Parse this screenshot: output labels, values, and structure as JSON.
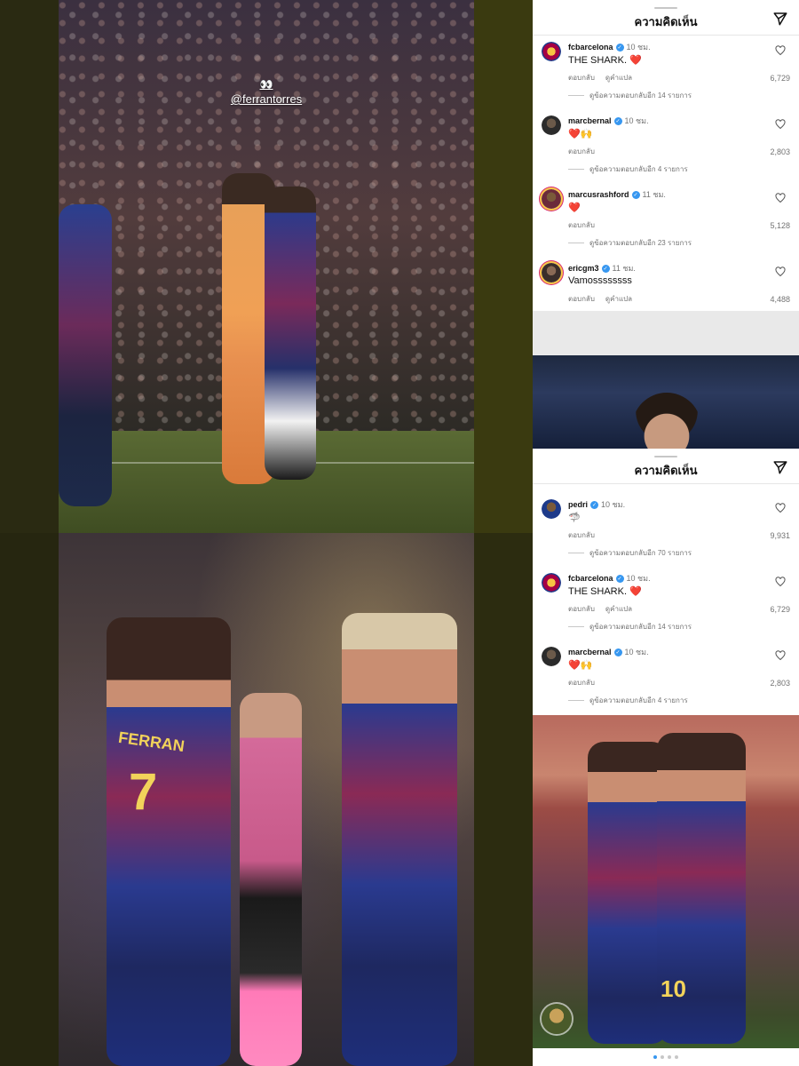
{
  "watermark": {
    "handle": "@ferrantorres",
    "emoji": "👀"
  },
  "photo_bottom": {
    "jersey_name": "FERRAN",
    "jersey_number": "7",
    "right_number": "10"
  },
  "panel1": {
    "title": "ความคิดเห็น",
    "comments": [
      {
        "username": "fcbarcelona",
        "time": "10 ชม.",
        "text": "THE SHARK. ❤️",
        "reply": "ตอบกลับ",
        "translate": "ดูคำแปล",
        "likes": "6,729",
        "replies": "ดูข้อความตอบกลับอีก 14 รายการ",
        "avatar_color": "#a50044"
      },
      {
        "username": "marcbernal",
        "time": "10 ชม.",
        "text": "❤️🙌",
        "reply": "ตอบกลับ",
        "translate": "",
        "likes": "2,803",
        "replies": "ดูข้อความตอบกลับอีก 4 รายการ",
        "avatar_color": "#2b2b2b"
      },
      {
        "username": "marcusrashford",
        "time": "11 ชม.",
        "text": "❤️",
        "reply": "ตอบกลับ",
        "translate": "",
        "likes": "5,128",
        "replies": "ดูข้อความตอบกลับอีก 23 รายการ",
        "avatar_color": "#6b2a3a"
      },
      {
        "username": "ericgm3",
        "time": "11 ชม.",
        "text": "Vamossssssss",
        "reply": "ตอบกลับ",
        "translate": "ดูคำแปล",
        "likes": "4,488",
        "replies": "",
        "avatar_color": "#3a2e2a"
      }
    ]
  },
  "panel2": {
    "title": "ความคิดเห็น",
    "comments": [
      {
        "username": "pedri",
        "time": "10 ชม.",
        "text": "🦈",
        "reply": "ตอบกลับ",
        "translate": "",
        "likes": "9,931",
        "replies": "ดูข้อความตอบกลับอีก 70 รายการ",
        "avatar_color": "#1d3a8a"
      },
      {
        "username": "fcbarcelona",
        "time": "10 ชม.",
        "text": "THE SHARK. ❤️",
        "reply": "ตอบกลับ",
        "translate": "ดูคำแปล",
        "likes": "6,729",
        "replies": "ดูข้อความตอบกลับอีก 14 รายการ",
        "avatar_color": "#a50044"
      },
      {
        "username": "marcbernal",
        "time": "10 ชม.",
        "text": "❤️🙌",
        "reply": "ตอบกลับ",
        "translate": "",
        "likes": "2,803",
        "replies": "ดูข้อความตอบกลับอีก 4 รายการ",
        "avatar_color": "#2b2b2b"
      }
    ]
  },
  "carousel": {
    "count": 4,
    "active": 0
  }
}
